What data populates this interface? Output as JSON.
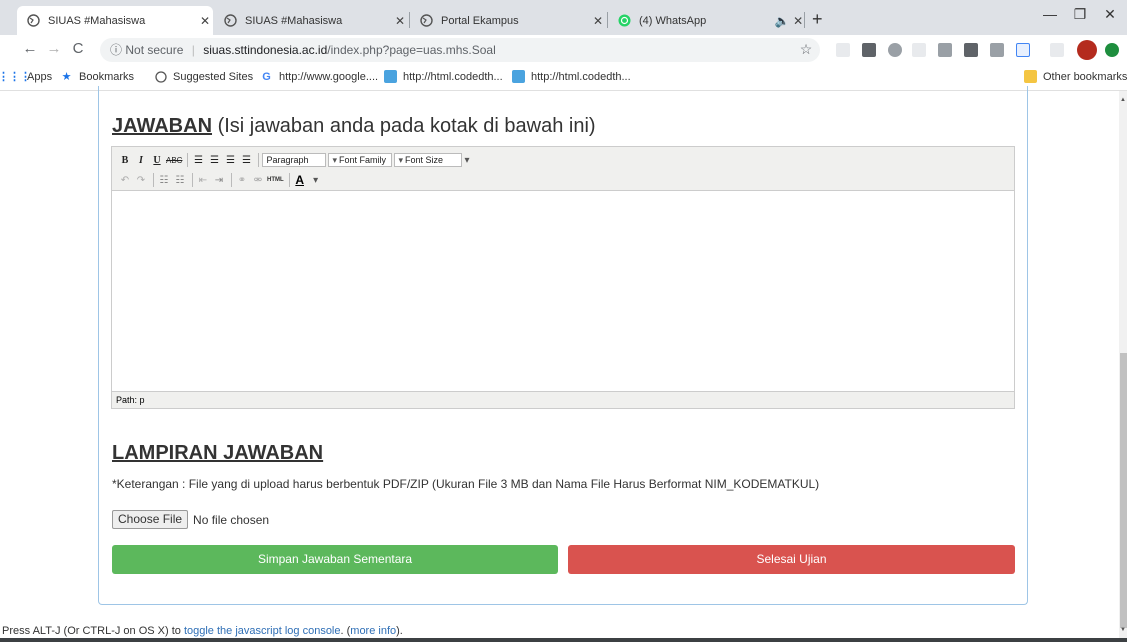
{
  "tabs": [
    {
      "title": "SIUAS #Mahasiswa",
      "active": true
    },
    {
      "title": "SIUAS #Mahasiswa",
      "active": false
    },
    {
      "title": "Portal Ekampus",
      "active": false
    },
    {
      "title": "(4) WhatsApp",
      "active": false
    }
  ],
  "address": {
    "security": "Not secure",
    "host": "siuas.sttindonesia.ac.id",
    "path": "/index.php?page=uas.mhs.Soal"
  },
  "bookmarks": {
    "apps": "Apps",
    "bookmarks": "Bookmarks",
    "suggested": "Suggested Sites",
    "google": "http://www.google....",
    "codedth1": "http://html.codedth...",
    "codedth2": "http://html.codedth...",
    "other": "Other bookmarks"
  },
  "answer": {
    "heading_strong": "JAWABAN",
    "heading_rest": " (Isi jawaban anda pada kotak di bawah ini)"
  },
  "editor": {
    "format_select": "Paragraph",
    "font_family_select": "Font Family",
    "font_size_select": "Font Size",
    "html_label": "HTML",
    "status_path": "Path: p"
  },
  "attachment": {
    "heading": "LAMPIRAN JAWABAN",
    "note": "*Keterangan : File yang di upload harus berbentuk PDF/ZIP (Ukuran File 3 MB dan Nama File Harus Berformat NIM_KODEMATKUL)",
    "choose_file": "Choose File",
    "no_file": "No file chosen"
  },
  "buttons": {
    "save_temp": "Simpan Jawaban Sementara",
    "finish": "Selesai Ujian"
  },
  "console": {
    "prefix": "Press ALT-J (Or CTRL-J on OS X) to ",
    "link1": "toggle the javascript log console",
    "mid": ". (",
    "link2": "more info",
    "suffix": ")."
  },
  "colors": {
    "save_button": "#5cb85c",
    "finish_button": "#d9534f",
    "panel_border": "#9ec5e6"
  }
}
